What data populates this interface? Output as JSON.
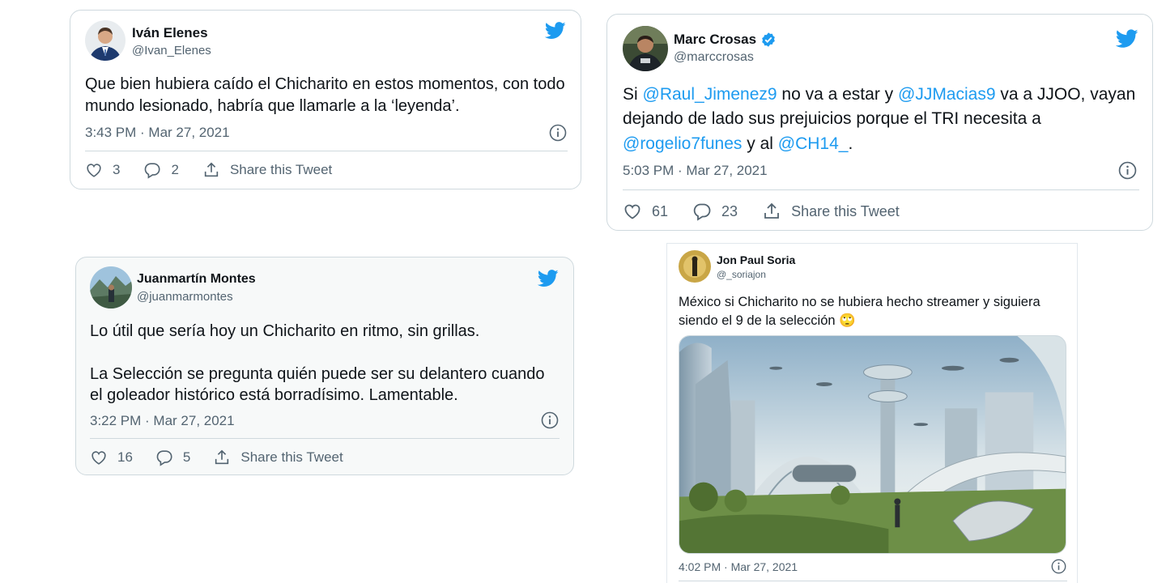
{
  "colors": {
    "twitter_blue": "#1d9bf0",
    "text": "#0f1419",
    "muted": "#536471",
    "border": "#cfd9de"
  },
  "tweets": [
    {
      "name": "Iván Elenes",
      "handle": "@Ivan_Elenes",
      "verified": false,
      "text_parts": [
        "Que bien hubiera caído el Chicharito en estos momentos, con todo mundo lesionado, habría que llamarle a la ‘leyenda’."
      ],
      "timestamp": "3:43 PM · Mar 27, 2021",
      "likes": "3",
      "replies": "2",
      "share_label": "Share this Tweet",
      "icons": [
        "avatar",
        "twitter-bird-icon",
        "info-icon",
        "heart-icon",
        "reply-icon",
        "share-icon"
      ]
    },
    {
      "name": "Marc Crosas",
      "handle": "@marccrosas",
      "verified": true,
      "text_parts": [
        "Si ",
        "@Raul_Jimenez9",
        " no va a estar y ",
        "@JJMacias9",
        " va a JJOO, vayan dejando de lado sus prejuicios porque el TRI necesita a ",
        "@rogelio7funes",
        " y al ",
        "@CH14_",
        "."
      ],
      "timestamp": "5:03 PM · Mar 27, 2021",
      "likes": "61",
      "replies": "23",
      "share_label": "Share this Tweet",
      "icons": [
        "avatar",
        "verified-badge-icon",
        "twitter-bird-icon",
        "info-icon",
        "heart-icon",
        "reply-icon",
        "share-icon"
      ]
    },
    {
      "name": "Juanmartín Montes",
      "handle": "@juanmarmontes",
      "verified": false,
      "text_paragraphs": [
        "Lo útil que sería hoy un Chicharito en ritmo, sin grillas.",
        "La Selección se pregunta quién puede ser su delantero cuando el goleador histórico está borradísimo. Lamentable."
      ],
      "timestamp": "3:22 PM · Mar 27, 2021",
      "likes": "16",
      "replies": "5",
      "share_label": "Share this Tweet",
      "icons": [
        "avatar",
        "twitter-bird-icon",
        "info-icon",
        "heart-icon",
        "reply-icon",
        "share-icon"
      ]
    },
    {
      "name": "Jon Paul Soria",
      "handle": "@_soriajon",
      "verified": false,
      "text_parts": [
        "México si Chicharito no se hubiera hecho streamer y siguiera siendo el 9 de la selección 🙄"
      ],
      "timestamp": "4:02 PM · Mar 27, 2021",
      "media": "futuristic-city-image",
      "icons": [
        "avatar",
        "info-icon"
      ]
    }
  ]
}
